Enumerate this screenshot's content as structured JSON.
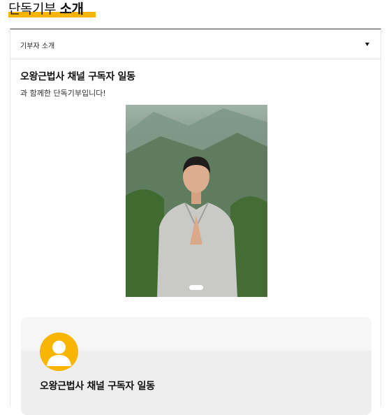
{
  "section": {
    "title_light": "단독기부",
    "title_bold": "소개"
  },
  "selector": {
    "selected": "기부자 소개"
  },
  "donor": {
    "heading": "오왕근법사 채널 구독자 일동",
    "subtext": "과 함께한 단독기부입니다!"
  },
  "profile": {
    "name": "오왕근법사 채널 구독자 일동"
  },
  "colors": {
    "accent": "#f7b500",
    "card_border": "#333333",
    "profile_bg": "#f6f6f6"
  },
  "icons": {
    "dropdown": "caret-down-icon",
    "avatar": "user-avatar-icon"
  }
}
